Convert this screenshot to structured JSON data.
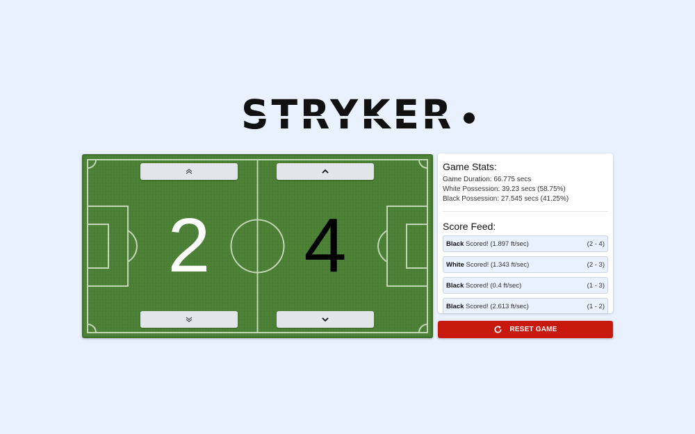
{
  "logo": {
    "text": "STRYKER"
  },
  "field": {
    "white_score": "2",
    "black_score": "4"
  },
  "controls": {
    "white_up_icon": "double-chevron-up-icon",
    "black_up_icon": "chevron-up-icon",
    "white_down_icon": "double-chevron-down-icon",
    "black_down_icon": "chevron-down-icon"
  },
  "stats": {
    "title": "Game Stats:",
    "duration": "Game Duration: 66.775 secs",
    "white_possession": "White Possession: 39.23 secs (58.75%)",
    "black_possession": "Black Possession: 27.545 secs (41.25%)",
    "feed_title": "Score Feed:",
    "feed": [
      {
        "team": "Black",
        "text": " Scored! (1.897 ft/sec)",
        "score": "(2 - 4)"
      },
      {
        "team": "White",
        "text": " Scored! (1.343 ft/sec)",
        "score": "(2 - 3)"
      },
      {
        "team": "Black",
        "text": " Scored! (0.4 ft/sec)",
        "score": "(1 - 3)"
      },
      {
        "team": "Black",
        "text": " Scored! (2.613 ft/sec)",
        "score": "(1 - 2)"
      }
    ]
  },
  "reset": {
    "label": "RESET GAME",
    "icon": "refresh-icon"
  },
  "colors": {
    "background": "#e9f0fe",
    "pitch": "#4a7f34",
    "reset": "#c8190f"
  }
}
